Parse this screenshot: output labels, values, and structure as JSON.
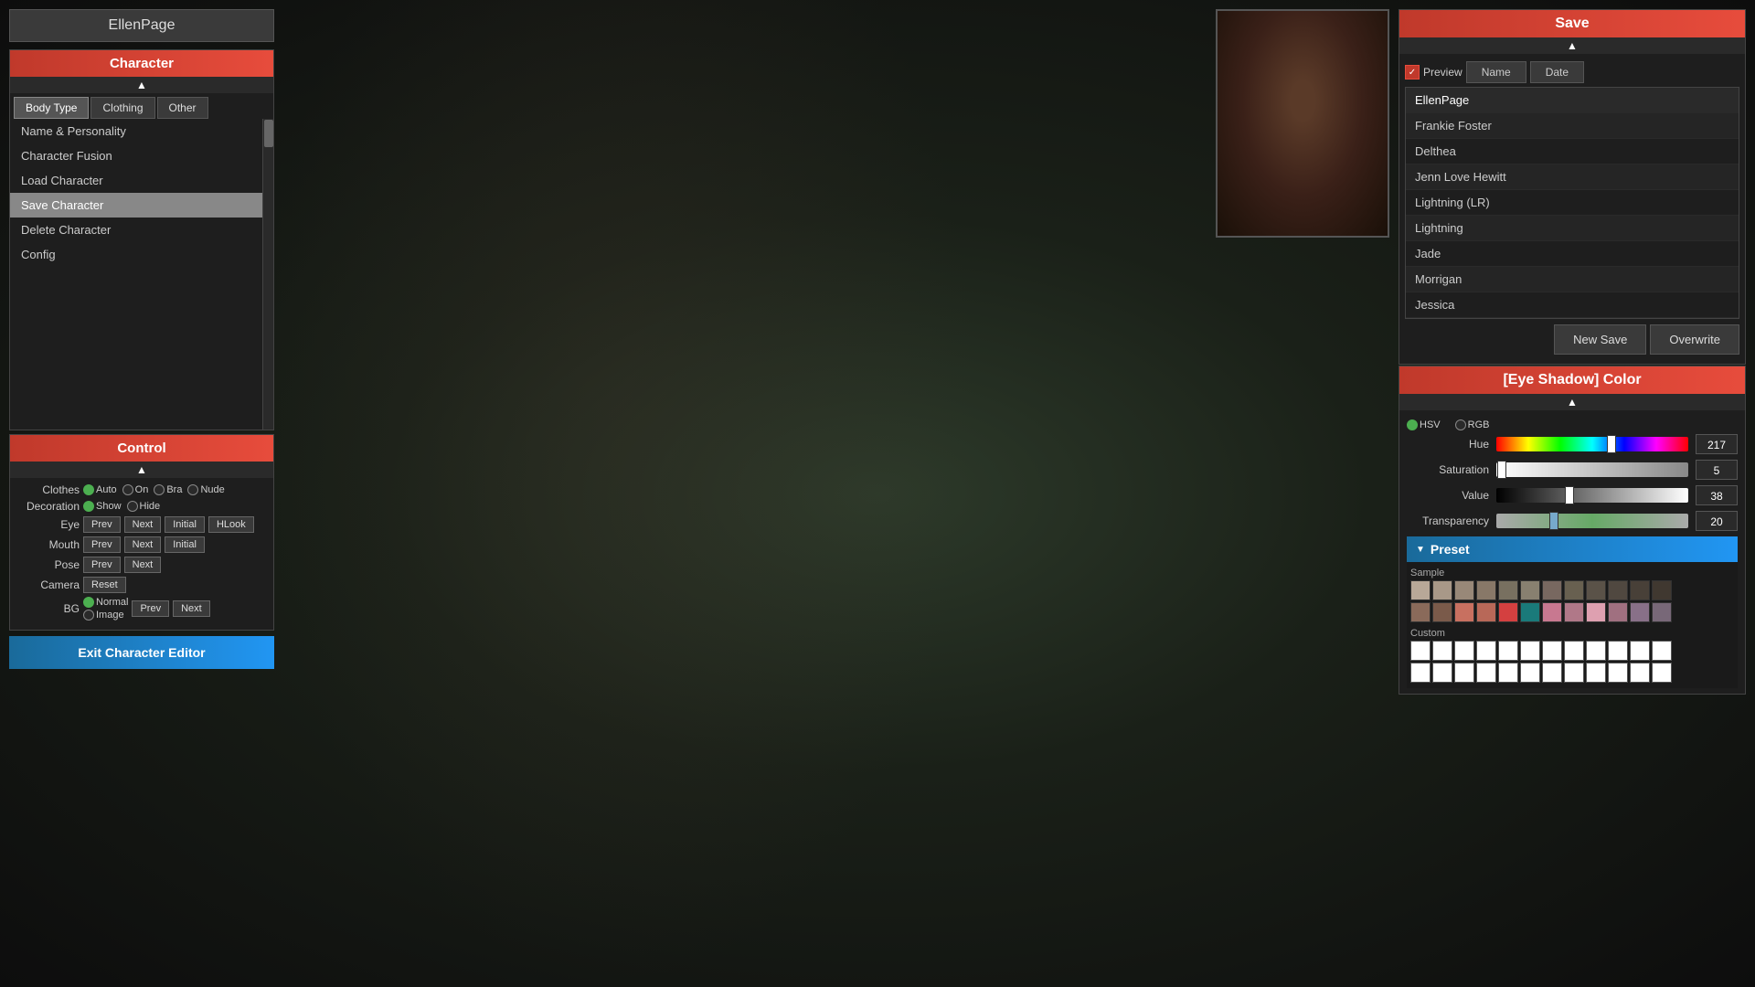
{
  "title": "EllenPage",
  "left": {
    "character_label": "Character",
    "tabs": [
      "Body Type",
      "Clothing",
      "Other"
    ],
    "active_tab": "Body Type",
    "menu_items": [
      "Name & Personality",
      "Character Fusion",
      "Load Character",
      "Save Character",
      "Delete Character",
      "Config"
    ],
    "selected_menu": "Save Character",
    "control_label": "Control",
    "control_arrow": "▲",
    "clothes_label": "Clothes",
    "clothes_options": [
      "Auto",
      "On",
      "Bra",
      "Nude"
    ],
    "clothes_checked": "Auto",
    "decoration_label": "Decoration",
    "decoration_options": [
      "Show",
      "Hide"
    ],
    "decoration_checked": "Show",
    "eye_label": "Eye",
    "eye_buttons": [
      "Prev",
      "Next",
      "Initial"
    ],
    "mouth_label": "Mouth",
    "mouth_buttons": [
      "Prev",
      "Next",
      "Initial"
    ],
    "hlook_label": "HLook",
    "pose_label": "Pose",
    "pose_buttons": [
      "Prev",
      "Next"
    ],
    "camera_label": "Camera",
    "camera_buttons": [
      "Reset"
    ],
    "bg_label": "BG",
    "bg_options": [
      "Normal",
      "Image"
    ],
    "bg_nav_buttons": [
      "Prev",
      "Next"
    ],
    "exit_label": "Exit Character Editor"
  },
  "save_panel": {
    "title": "Save",
    "arrow": "▲",
    "preview_label": "Preview",
    "sort_name": "Name",
    "sort_date": "Date",
    "characters": [
      "EllenPage",
      "Frankie Foster",
      "Delthea",
      "Jenn Love Hewitt",
      "Lightning (LR)",
      "Lightning",
      "Jade",
      "Morrigan",
      "Jessica"
    ],
    "new_save_label": "New Save",
    "overwrite_label": "Overwrite"
  },
  "color_panel": {
    "title": "[Eye Shadow] Color",
    "arrow": "▲",
    "mode_hsv": "HSV",
    "mode_rgb": "RGB",
    "active_mode": "HSV",
    "hue_label": "Hue",
    "hue_value": 217,
    "hue_position_pct": 60,
    "saturation_label": "Saturation",
    "saturation_value": 5,
    "saturation_position_pct": 3,
    "value_label": "Value",
    "value_value": 38,
    "value_position_pct": 38,
    "transparency_label": "Transparency",
    "transparency_value": 20,
    "transparency_position_pct": 30,
    "preset_label": "Preset",
    "sample_label": "Sample",
    "custom_label": "Custom",
    "sample_swatches_row1": [
      "#b8a898",
      "#a89888",
      "#988878",
      "#887868",
      "#787060",
      "#888070",
      "#786860",
      "#686050",
      "#5a5248",
      "#504840",
      "#484038",
      "#403830"
    ],
    "sample_swatches_row2": [
      "#8a6a5a",
      "#7a5a4a",
      "#c87060",
      "#b86858",
      "#d44040",
      "#1a7a7a",
      "#c87890",
      "#b07888",
      "#dea0b0",
      "#a07080",
      "#887088",
      "#786878"
    ],
    "custom_swatches": [
      "#ffffff",
      "#ffffff",
      "#ffffff",
      "#ffffff",
      "#ffffff",
      "#ffffff",
      "#ffffff",
      "#ffffff",
      "#ffffff",
      "#ffffff",
      "#ffffff",
      "#ffffff",
      "#ffffff",
      "#ffffff",
      "#ffffff",
      "#ffffff",
      "#ffffff",
      "#ffffff",
      "#ffffff",
      "#ffffff",
      "#ffffff",
      "#ffffff",
      "#ffffff",
      "#ffffff"
    ]
  }
}
